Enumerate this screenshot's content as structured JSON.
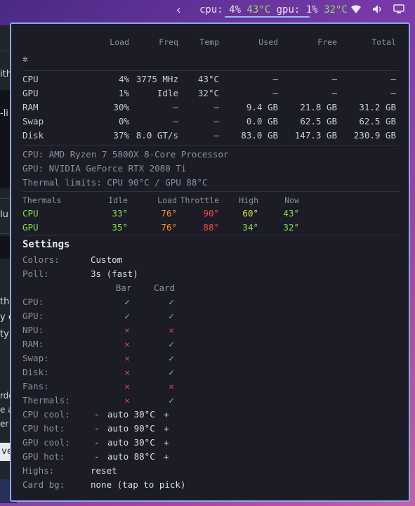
{
  "topbar": {
    "cpu_label": "cpu:",
    "cpu_load": "4%",
    "cpu_temp": "43°C",
    "gpu_label": "gpu:",
    "gpu_load": "1%",
    "gpu_temp": "32°C"
  },
  "background_fragments": [
    "ith",
    "-li",
    "lu",
    "th",
    "y c",
    "ty",
    "rde",
    "e a",
    "er",
    "ve"
  ],
  "table": {
    "headers": [
      "Load",
      "Freq",
      "Temp",
      "Used",
      "Free",
      "Total"
    ],
    "rows": [
      {
        "name": "CPU",
        "load": "4%",
        "freq": "3775 MHz",
        "temp": "43°C",
        "used": "—",
        "free": "—",
        "total": "—"
      },
      {
        "name": "GPU",
        "load": "1%",
        "freq": "Idle",
        "temp": "32°C",
        "used": "—",
        "free": "—",
        "total": "—"
      },
      {
        "name": "RAM",
        "load": "30%",
        "freq": "—",
        "temp": "—",
        "used": "9.4 GB",
        "free": "21.8 GB",
        "total": "31.2 GB"
      },
      {
        "name": "Swap",
        "load": "0%",
        "freq": "—",
        "temp": "—",
        "used": "0.0 GB",
        "free": "62.5 GB",
        "total": "62.5 GB"
      },
      {
        "name": "Disk",
        "load": "37%",
        "freq": "8.0 GT/s",
        "temp": "—",
        "used": "83.0 GB",
        "free": "147.3 GB",
        "total": "230.9 GB"
      }
    ]
  },
  "info": {
    "cpu": "CPU: AMD Ryzen 7 5800X 8-Core Processor",
    "gpu": "GPU: NVIDIA GeForce RTX 2080 Ti",
    "limits": "Thermal limits: CPU 90°C / GPU 88°C"
  },
  "thermals": {
    "headers": [
      "Thermals",
      "Idle",
      "Load",
      "Throttle",
      "High",
      "Now"
    ],
    "rows": [
      {
        "name": "CPU",
        "idle": "33°",
        "load": "76°",
        "throttle": "90°",
        "high": "60°",
        "now": "43°"
      },
      {
        "name": "GPU",
        "idle": "35°",
        "load": "76°",
        "throttle": "88°",
        "high": "34°",
        "now": "32°"
      }
    ]
  },
  "settings": {
    "title": "Settings",
    "colors_label": "Colors:",
    "colors_value": "Custom",
    "poll_label": "Poll:",
    "poll_value": "3s (fast)",
    "bar_header": "Bar",
    "card_header": "Card",
    "toggles": [
      {
        "label": "CPU:",
        "bar": "✓",
        "card": "✓"
      },
      {
        "label": "GPU:",
        "bar": "✓",
        "card": "✓"
      },
      {
        "label": "NPU:",
        "bar": "✕",
        "card": "✕"
      },
      {
        "label": "RAM:",
        "bar": "✕",
        "card": "✓"
      },
      {
        "label": "Swap:",
        "bar": "✕",
        "card": "✓"
      },
      {
        "label": "Disk:",
        "bar": "✕",
        "card": "✓"
      },
      {
        "label": "Fans:",
        "bar": "✕",
        "card": "✕"
      },
      {
        "label": "Thermals:",
        "bar": "✕",
        "card": "✓"
      }
    ],
    "steppers": [
      {
        "label": "CPU cool:",
        "minus": "-",
        "value": "auto 30°C",
        "plus": "+"
      },
      {
        "label": "CPU hot:",
        "minus": "-",
        "value": "auto 90°C",
        "plus": "+"
      },
      {
        "label": "GPU cool:",
        "minus": "-",
        "value": "auto 30°C",
        "plus": "+"
      },
      {
        "label": "GPU hot:",
        "minus": "-",
        "value": "auto 88°C",
        "plus": "+"
      }
    ],
    "highs_label": "Highs:",
    "highs_value": "reset",
    "cardbg_label": "Card bg:",
    "cardbg_value": "none (tap to pick)"
  }
}
